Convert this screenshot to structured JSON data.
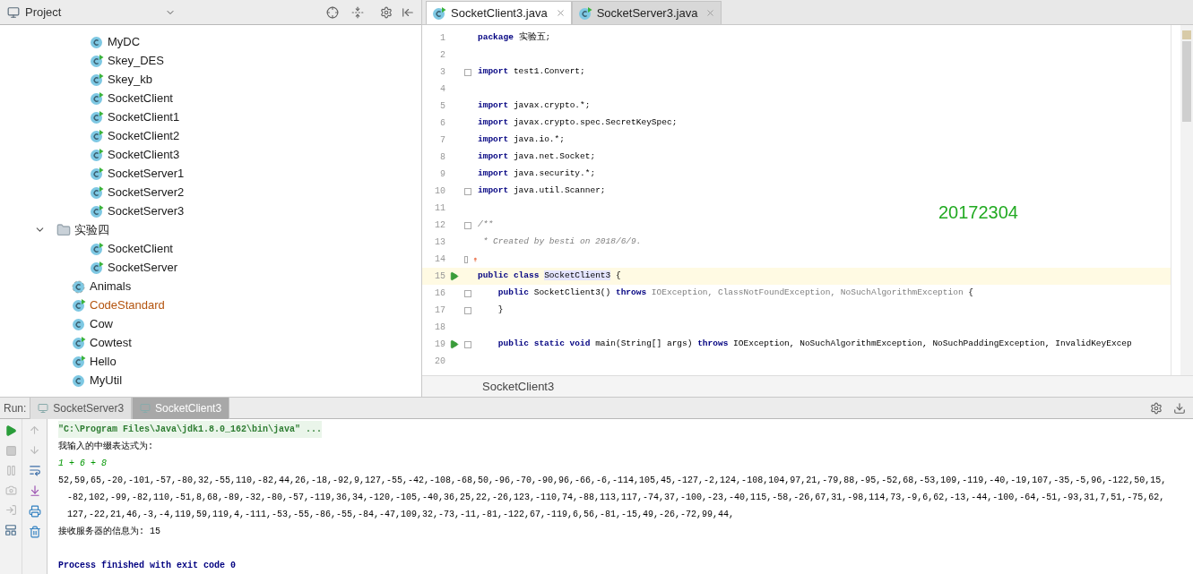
{
  "project_panel": {
    "title": "Project",
    "tree": {
      "continued_children": [
        {
          "label": "MyDC",
          "kind": "class",
          "modified": false
        },
        {
          "label": "Skey_DES",
          "kind": "runnable",
          "modified": false
        },
        {
          "label": "Skey_kb",
          "kind": "runnable",
          "modified": false
        },
        {
          "label": "SocketClient",
          "kind": "runnable",
          "modified": false
        },
        {
          "label": "SocketClient1",
          "kind": "runnable",
          "modified": false
        },
        {
          "label": "SocketClient2",
          "kind": "runnable",
          "modified": false
        },
        {
          "label": "SocketClient3",
          "kind": "runnable",
          "modified": false
        },
        {
          "label": "SocketServer1",
          "kind": "runnable",
          "modified": false
        },
        {
          "label": "SocketServer2",
          "kind": "runnable",
          "modified": false
        },
        {
          "label": "SocketServer3",
          "kind": "runnable",
          "modified": false
        }
      ],
      "items": [
        {
          "label": "实验四",
          "kind": "folder",
          "modified": false,
          "expanded": true,
          "children": [
            {
              "label": "SocketClient",
              "kind": "runnable",
              "modified": false
            },
            {
              "label": "SocketServer",
              "kind": "runnable",
              "modified": false
            }
          ]
        },
        {
          "label": "Animals",
          "kind": "abstract",
          "modified": false
        },
        {
          "label": "CodeStandard",
          "kind": "runnable",
          "modified": true
        },
        {
          "label": "Cow",
          "kind": "class",
          "modified": false
        },
        {
          "label": "Cowtest",
          "kind": "runnable",
          "modified": false
        },
        {
          "label": "Hello",
          "kind": "runnable",
          "modified": false
        },
        {
          "label": "MyUtil",
          "kind": "class",
          "modified": false
        }
      ]
    }
  },
  "editor": {
    "tabs": [
      {
        "label": "SocketClient3.java",
        "selected": true
      },
      {
        "label": "SocketServer3.java",
        "selected": false
      }
    ],
    "lines": [
      {
        "number": "1",
        "current": false,
        "run": false,
        "fold": false,
        "bulb": false,
        "segments": [
          {
            "kind": "keyword",
            "text": "package"
          },
          {
            "kind": "plain",
            "text": " 实验五;"
          }
        ]
      },
      {
        "number": "2",
        "current": false,
        "run": false,
        "fold": false,
        "bulb": false
      },
      {
        "number": "3",
        "current": false,
        "run": false,
        "fold": true,
        "bulb": false,
        "segments": [
          {
            "kind": "keyword",
            "text": "import"
          },
          {
            "kind": "plain",
            "text": " test1.Convert;"
          }
        ]
      },
      {
        "number": "4",
        "current": false,
        "run": false,
        "fold": false,
        "bulb": false
      },
      {
        "number": "5",
        "current": false,
        "run": false,
        "fold": false,
        "bulb": false,
        "segments": [
          {
            "kind": "keyword",
            "text": "import"
          },
          {
            "kind": "plain",
            "text": " javax.crypto.*;"
          }
        ]
      },
      {
        "number": "6",
        "current": false,
        "run": false,
        "fold": false,
        "bulb": false,
        "segments": [
          {
            "kind": "keyword",
            "text": "import"
          },
          {
            "kind": "plain",
            "text": " javax.crypto.spec.SecretKeySpec;"
          }
        ]
      },
      {
        "number": "7",
        "current": false,
        "run": false,
        "fold": false,
        "bulb": false,
        "segments": [
          {
            "kind": "keyword",
            "text": "import"
          },
          {
            "kind": "plain",
            "text": " java.io.*;"
          }
        ]
      },
      {
        "number": "8",
        "current": false,
        "run": false,
        "fold": false,
        "bulb": false,
        "segments": [
          {
            "kind": "keyword",
            "text": "import"
          },
          {
            "kind": "plain",
            "text": " java.net.Socket;"
          }
        ]
      },
      {
        "number": "9",
        "current": false,
        "run": false,
        "fold": false,
        "bulb": false,
        "segments": [
          {
            "kind": "keyword",
            "text": "import"
          },
          {
            "kind": "plain",
            "text": " java.security.*;"
          }
        ]
      },
      {
        "number": "10",
        "current": false,
        "run": false,
        "fold": true,
        "bulb": false,
        "segments": [
          {
            "kind": "keyword",
            "text": "import"
          },
          {
            "kind": "plain",
            "text": " java.util.Scanner;"
          }
        ]
      },
      {
        "number": "11",
        "current": false,
        "run": false,
        "fold": false,
        "bulb": false
      },
      {
        "number": "12",
        "current": false,
        "run": false,
        "fold": true,
        "bulb": false,
        "segments": [
          {
            "kind": "comment",
            "text": "/**"
          }
        ]
      },
      {
        "number": "13",
        "current": false,
        "run": false,
        "fold": false,
        "bulb": false,
        "segments": [
          {
            "kind": "comment",
            "text": " * Created by besti on 2018/6/9."
          }
        ]
      },
      {
        "number": "14",
        "current": false,
        "run": false,
        "fold": true,
        "bulb": true
      },
      {
        "number": "15",
        "current": true,
        "run": true,
        "fold": false,
        "bulb": false,
        "segments": [
          {
            "kind": "keyword",
            "text": "public class "
          },
          {
            "kind": "highlight",
            "text": "SocketClient3"
          },
          {
            "kind": "plain",
            "text": " {"
          }
        ]
      },
      {
        "number": "16",
        "current": false,
        "run": false,
        "fold": true,
        "bulb": false,
        "segments": [
          {
            "kind": "keyword",
            "text": "    public "
          },
          {
            "kind": "plain",
            "text": "SocketClient3() "
          },
          {
            "kind": "keyword",
            "text": "throws "
          },
          {
            "kind": "unused",
            "text": "IOException, ClassNotFoundException, NoSuchAlgorithmException"
          },
          {
            "kind": "plain",
            "text": " {"
          }
        ]
      },
      {
        "number": "17",
        "current": false,
        "run": false,
        "fold": true,
        "bulb": false,
        "segments": [
          {
            "kind": "plain",
            "text": "    }"
          }
        ]
      },
      {
        "number": "18",
        "current": false,
        "run": false,
        "fold": false,
        "bulb": false
      },
      {
        "number": "19",
        "current": false,
        "run": true,
        "fold": true,
        "bulb": false,
        "segments": [
          {
            "kind": "keyword",
            "text": "    public static void "
          },
          {
            "kind": "plain",
            "text": "main(String[] args) "
          },
          {
            "kind": "keyword",
            "text": "throws "
          },
          {
            "kind": "plain",
            "text": "IOException, NoSuchAlgorithmException, NoSuchPaddingException, InvalidKeyExcep"
          }
        ]
      },
      {
        "number": "20",
        "current": false,
        "run": false,
        "fold": false,
        "bulb": false
      }
    ],
    "overlay_text": "20172304",
    "breadcrumb": "SocketClient3"
  },
  "run_panel": {
    "label": "Run:",
    "tabs": [
      {
        "label": "SocketServer3",
        "selected": false
      },
      {
        "label": "SocketClient3",
        "selected": true
      }
    ],
    "console": [
      {
        "kind": "command",
        "text": "\"C:\\Program Files\\Java\\jdk1.8.0_162\\bin\\java\" ..."
      },
      {
        "kind": "output",
        "text": "我输入的中缀表达式为:"
      },
      {
        "kind": "input",
        "text": "1 + 6 + 8"
      },
      {
        "kind": "output",
        "text": "52,59,65,-20,-101,-57,-80,32,-55,110,-82,44,26,-18,-92,9,127,-55,-42,-108,-68,50,-96,-70,-90,96,-66,-6,-114,105,45,-127,-2,124,-108,104,97,21,-79,88,-95,-52,68,-53,109,-119,-40,-19,107,-35,-5,96,-122,50,15,"
      },
      {
        "kind": "continued",
        "text": "-82,102,-99,-82,110,-51,8,68,-89,-32,-80,-57,-119,36,34,-120,-105,-40,36,25,22,-26,123,-110,74,-88,113,117,-74,37,-100,-23,-40,115,-58,-26,67,31,-98,114,73,-9,6,62,-13,-44,-100,-64,-51,-93,31,7,51,-75,62,"
      },
      {
        "kind": "continued",
        "text": "127,-22,21,46,-3,-4,119,59,119,4,-111,-53,-55,-86,-55,-84,-47,109,32,-73,-11,-81,-122,67,-119,6,56,-81,-15,49,-26,-72,99,44,"
      },
      {
        "kind": "output",
        "text": "接收服务器的信息为: 15"
      },
      {
        "kind": "exit",
        "text": "Process finished with exit code 0"
      }
    ]
  }
}
